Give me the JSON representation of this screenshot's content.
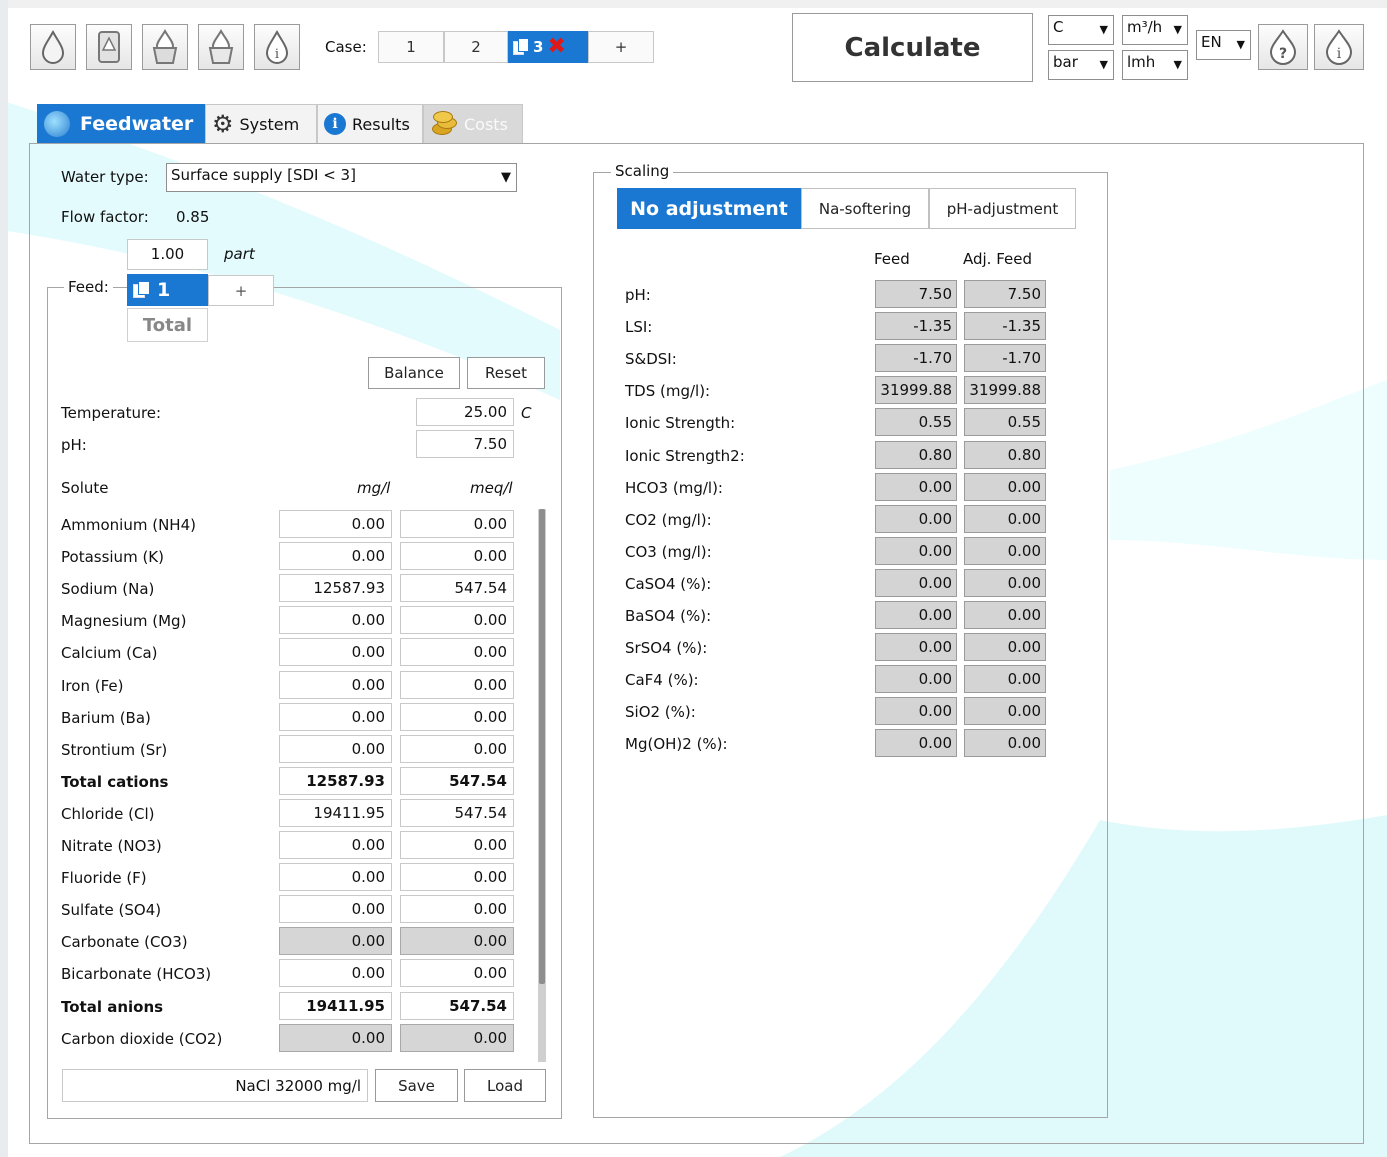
{
  "toolbar": {
    "icons": [
      "water-drop-icon",
      "water-tank-icon",
      "water-bucket-icon",
      "water-bucket-icon-2",
      "info-drop-icon"
    ],
    "case_label": "Case:",
    "cases": [
      "1",
      "2",
      "3"
    ],
    "active_case": "3",
    "add_case": "+",
    "calculate": "Calculate",
    "temp_unit": "C",
    "flow_unit": "m³/h",
    "pressure_unit": "bar",
    "flux_unit": "lmh",
    "language": "EN"
  },
  "tabs": {
    "feedwater": "Feedwater",
    "system": "System",
    "results": "Results",
    "costs": "Costs"
  },
  "water": {
    "type_label": "Water type:",
    "type_value": "Surface supply [SDI < 3]",
    "flow_factor_label": "Flow factor:",
    "flow_factor_value": "0.85",
    "part_value": "1.00",
    "part_label": "part",
    "feed_label": "Feed:",
    "feed_tab": "1",
    "feed_add": "+",
    "total_tab": "Total",
    "balance": "Balance",
    "reset": "Reset",
    "temperature_label": "Temperature:",
    "temperature_value": "25.00",
    "temperature_unit": "C",
    "ph_label": "pH:",
    "ph_value": "7.50",
    "solute_header": "Solute",
    "mg_header": "mg/l",
    "meq_header": "meq/l",
    "solutes": [
      {
        "name": "Ammonium (NH4)",
        "mg": "0.00",
        "meq": "0.00"
      },
      {
        "name": "Potassium (K)",
        "mg": "0.00",
        "meq": "0.00"
      },
      {
        "name": "Sodium (Na)",
        "mg": "12587.93",
        "meq": "547.54"
      },
      {
        "name": "Magnesium (Mg)",
        "mg": "0.00",
        "meq": "0.00"
      },
      {
        "name": "Calcium (Ca)",
        "mg": "0.00",
        "meq": "0.00"
      },
      {
        "name": "Iron (Fe)",
        "mg": "0.00",
        "meq": "0.00"
      },
      {
        "name": "Barium (Ba)",
        "mg": "0.00",
        "meq": "0.00"
      },
      {
        "name": "Strontium (Sr)",
        "mg": "0.00",
        "meq": "0.00"
      },
      {
        "name": "Total cations",
        "mg": "12587.93",
        "meq": "547.54"
      },
      {
        "name": "Chloride (Cl)",
        "mg": "19411.95",
        "meq": "547.54"
      },
      {
        "name": "Nitrate (NO3)",
        "mg": "0.00",
        "meq": "0.00"
      },
      {
        "name": "Fluoride (F)",
        "mg": "0.00",
        "meq": "0.00"
      },
      {
        "name": "Sulfate (SO4)",
        "mg": "0.00",
        "meq": "0.00"
      },
      {
        "name": "Carbonate (CO3)",
        "mg": "0.00",
        "meq": "0.00"
      },
      {
        "name": "Bicarbonate (HCO3)",
        "mg": "0.00",
        "meq": "0.00"
      },
      {
        "name": "Total anions",
        "mg": "19411.95",
        "meq": "547.54"
      },
      {
        "name": "Carbon dioxide (CO2)",
        "mg": "0.00",
        "meq": "0.00"
      }
    ],
    "preset_value": "NaCl 32000 mg/l",
    "save": "Save",
    "load": "Load"
  },
  "scaling": {
    "title": "Scaling",
    "tabs": [
      "No adjustment",
      "Na-softering",
      "pH-adjustment"
    ],
    "active_tab": "No adjustment",
    "feed_header": "Feed",
    "adj_header": "Adj. Feed",
    "rows": [
      {
        "label": "pH:",
        "feed": "7.50",
        "adj": "7.50"
      },
      {
        "label": "LSI:",
        "feed": "-1.35",
        "adj": "-1.35"
      },
      {
        "label": "S&DSI:",
        "feed": "-1.70",
        "adj": "-1.70"
      },
      {
        "label": "TDS (mg/l):",
        "feed": "31999.88",
        "adj": "31999.88"
      },
      {
        "label": "Ionic Strength:",
        "feed": "0.55",
        "adj": "0.55"
      },
      {
        "label": "Ionic Strength2:",
        "feed": "0.80",
        "adj": "0.80"
      },
      {
        "label": "HCO3 (mg/l):",
        "feed": "0.00",
        "adj": "0.00"
      },
      {
        "label": "CO2 (mg/l):",
        "feed": "0.00",
        "adj": "0.00"
      },
      {
        "label": "CO3 (mg/l):",
        "feed": "0.00",
        "adj": "0.00"
      },
      {
        "label": "CaSO4 (%):",
        "feed": "0.00",
        "adj": "0.00"
      },
      {
        "label": "BaSO4 (%):",
        "feed": "0.00",
        "adj": "0.00"
      },
      {
        "label": "SrSO4 (%):",
        "feed": "0.00",
        "adj": "0.00"
      },
      {
        "label": "CaF4 (%):",
        "feed": "0.00",
        "adj": "0.00"
      },
      {
        "label": "SiO2 (%):",
        "feed": "0.00",
        "adj": "0.00"
      },
      {
        "label": "Mg(OH)2 (%):",
        "feed": "0.00",
        "adj": "0.00"
      }
    ]
  },
  "colors": {
    "accent": "#1a78d2",
    "accent_light": "#3f95e6",
    "background_wave": "#e3fbfd",
    "grey_field": "#d6d6d6"
  }
}
